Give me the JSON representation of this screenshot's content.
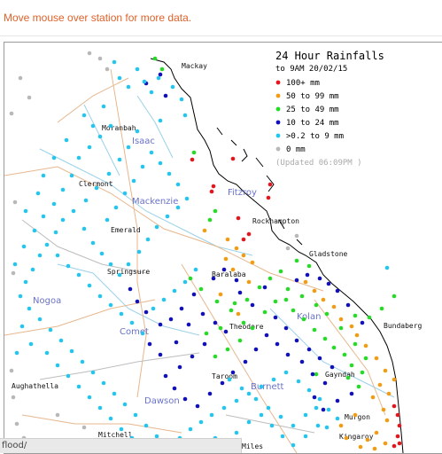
{
  "hint_text": "Move mouse over station for more data.",
  "status_url": "flood/",
  "legend": {
    "title": "24 Hour Rainfalls",
    "subtitle": "to 9AM 20/02/15",
    "items": [
      {
        "label": "100+ mm",
        "color": "#e8141b"
      },
      {
        "label": "50  to 99 mm",
        "color": "#f39c12"
      },
      {
        "label": "25  to 49 mm",
        "color": "#22dd22"
      },
      {
        "label": "10  to 24 mm",
        "color": "#1010c0"
      },
      {
        "label": ">0.2 to 9 mm",
        "color": "#22c6f0"
      },
      {
        "label": "0 mm",
        "color": "#b8b8b8"
      }
    ],
    "updated": "(Updated 06:09PM  )"
  },
  "towns": [
    "Mackay",
    "Moranbah",
    "Clermont",
    "Emerald",
    "Springsure",
    "Baralaba",
    "Rockhampton",
    "Gladstone",
    "Theodore",
    "Taroom",
    "Gayndah",
    "Bundaberg",
    "Aughathella",
    "Mitchell",
    "Murgon",
    "Kingaroy",
    "Miles"
  ],
  "regions": [
    "Isaac",
    "Fitzroy",
    "Mackenzie",
    "Nogoa",
    "Comet",
    "Dawson",
    "Burnett",
    "Kolan"
  ]
}
